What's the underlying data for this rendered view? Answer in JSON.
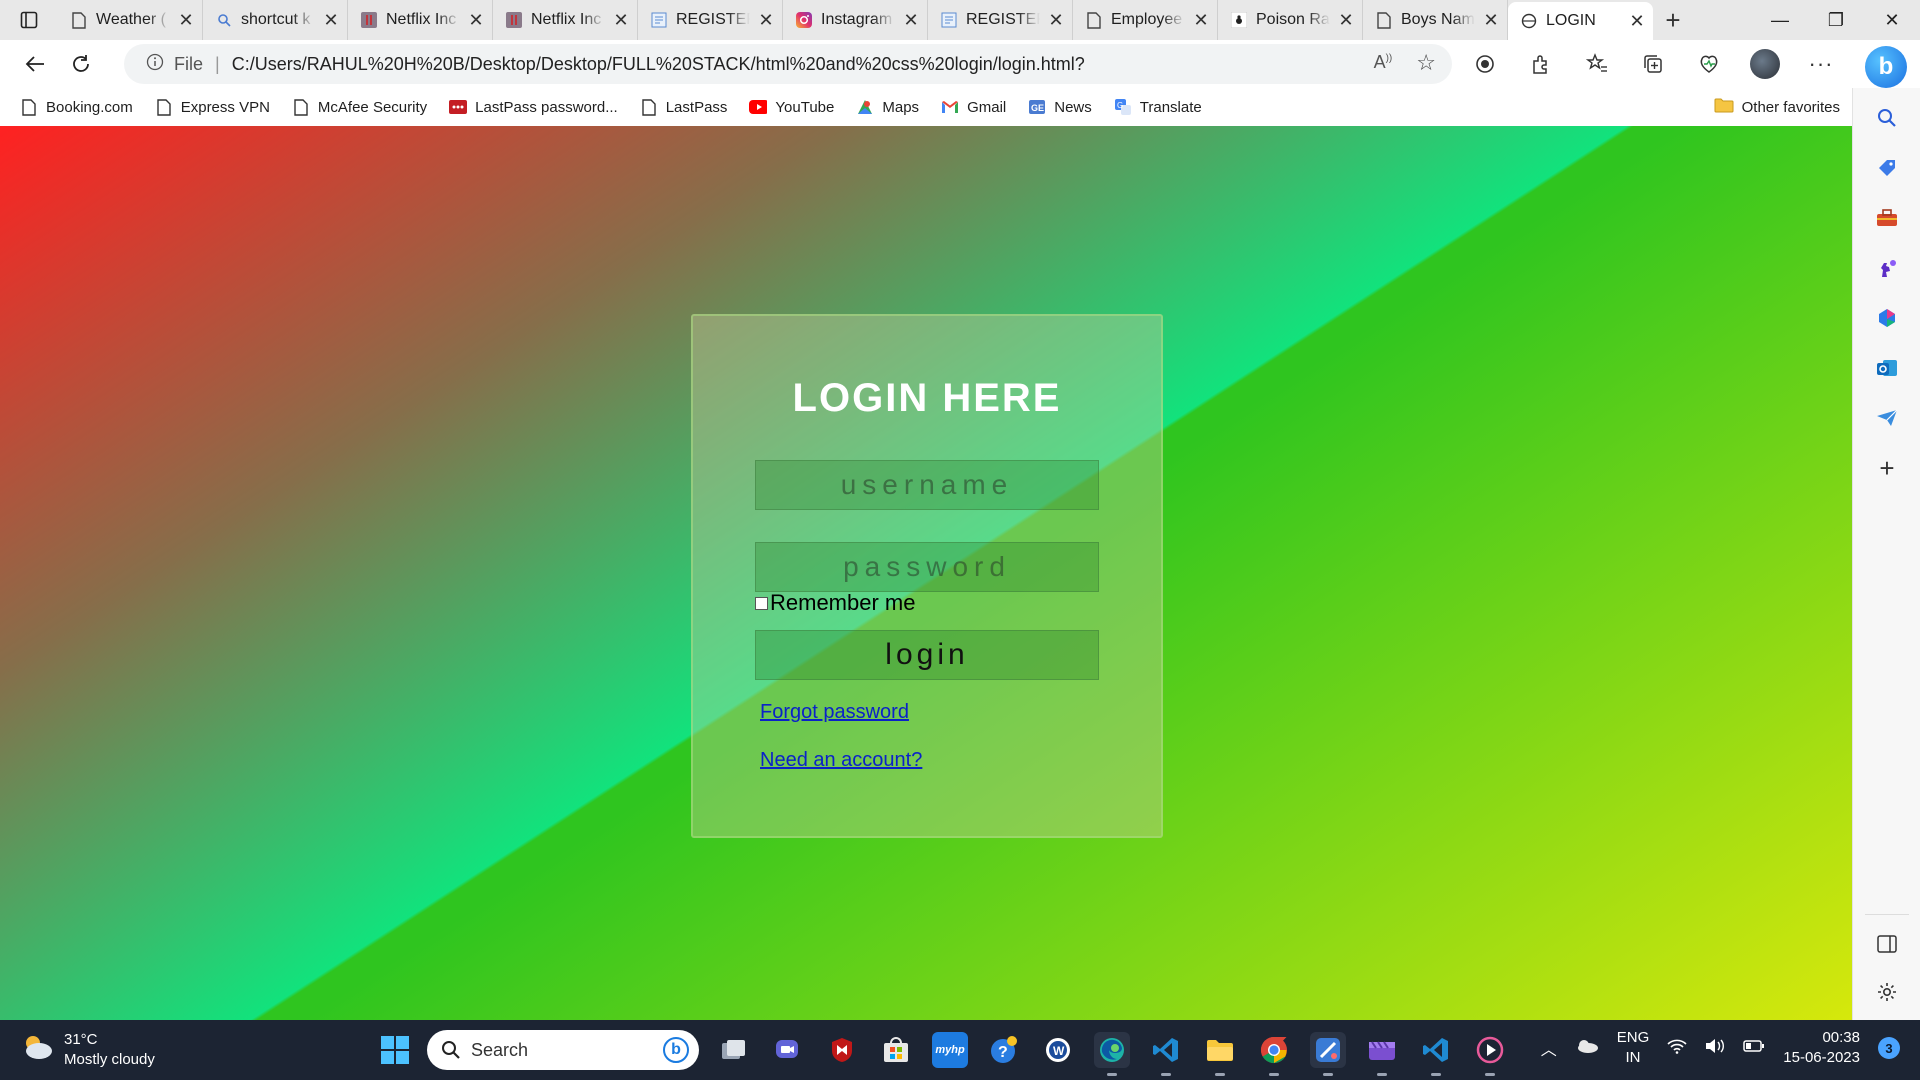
{
  "browser": {
    "tabs": [
      {
        "title": "Weather (",
        "icon": "page-icon",
        "active": false
      },
      {
        "title": "shortcut k",
        "icon": "search-icon",
        "active": false
      },
      {
        "title": "Netflix Inc",
        "icon": "netflix-icon",
        "active": false
      },
      {
        "title": "Netflix Inc",
        "icon": "netflix-icon",
        "active": false
      },
      {
        "title": "REGISTER",
        "icon": "form-icon",
        "active": false
      },
      {
        "title": "Instagram",
        "icon": "instagram-icon",
        "active": false
      },
      {
        "title": "REGISTER",
        "icon": "form-icon",
        "active": false
      },
      {
        "title": "Employee",
        "icon": "page-icon",
        "active": false
      },
      {
        "title": "Poison Ra",
        "icon": "ant-icon",
        "active": false
      },
      {
        "title": "Boys Nam",
        "icon": "page-icon",
        "active": false
      },
      {
        "title": "LOGIN",
        "icon": "globe-icon",
        "active": true
      }
    ],
    "address": {
      "scheme_label": "File",
      "url": "C:/Users/RAHUL%20H%20B/Desktop/Desktop/FULL%20STACK/html%20and%20css%20login/login.html?"
    },
    "bookmarks": [
      {
        "label": "Booking.com",
        "icon": "page-icon"
      },
      {
        "label": "Express VPN",
        "icon": "page-icon"
      },
      {
        "label": "McAfee Security",
        "icon": "page-icon"
      },
      {
        "label": "LastPass password...",
        "icon": "lastpass-icon"
      },
      {
        "label": "LastPass",
        "icon": "page-icon"
      },
      {
        "label": "YouTube",
        "icon": "youtube-icon"
      },
      {
        "label": "Maps",
        "icon": "maps-icon"
      },
      {
        "label": "Gmail",
        "icon": "gmail-icon"
      },
      {
        "label": "News",
        "icon": "news-icon"
      },
      {
        "label": "Translate",
        "icon": "translate-icon"
      }
    ],
    "other_favorites": "Other favorites"
  },
  "page": {
    "title": "LOGIN HERE",
    "username_placeholder": "username",
    "password_placeholder": "password",
    "remember_label": "Remember me",
    "login_button": "login",
    "forgot_link": "Forgot password",
    "need_account_link": "Need an account?"
  },
  "taskbar": {
    "weather_temp": "31°C",
    "weather_desc": "Mostly cloudy",
    "search_placeholder": "Search",
    "lang_top": "ENG",
    "lang_bottom": "IN",
    "time": "00:38",
    "date": "15-06-2023",
    "notifications": "3"
  }
}
